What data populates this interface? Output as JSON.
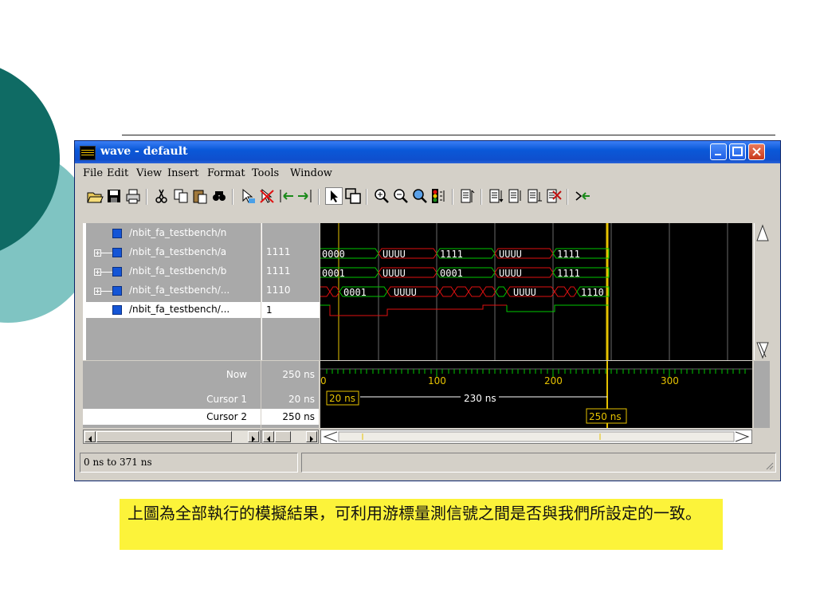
{
  "window": {
    "title": "wave - default"
  },
  "menu": [
    "File",
    "Edit",
    "View",
    "Insert",
    "Format",
    "Tools",
    "Window"
  ],
  "signals": [
    {
      "name": "/nbit_fa_testbench/n",
      "value": ""
    },
    {
      "name": "/nbit_fa_testbench/a",
      "value": "1111"
    },
    {
      "name": "/nbit_fa_testbench/b",
      "value": "1111"
    },
    {
      "name": "/nbit_fa_testbench/...",
      "value": "1110"
    },
    {
      "name": "/nbit_fa_testbench/...",
      "value": "1"
    }
  ],
  "wave_labels": {
    "a": [
      "0000",
      "UUUU",
      "1111",
      "UUUU",
      "1111"
    ],
    "b": [
      "0001",
      "UUUU",
      "0001",
      "UUUU",
      "1111"
    ],
    "sum": [
      "0001",
      "UUUU",
      "UUUU",
      "1110"
    ]
  },
  "cursors": {
    "now_label": "Now",
    "now_value": "250 ns",
    "c1_label": "Cursor 1",
    "c1_value": "20 ns",
    "c2_label": "Cursor 2",
    "c2_value": "250 ns",
    "ticks": [
      "0",
      "100",
      "200",
      "300"
    ],
    "c1_box": "20 ns",
    "delta": "230 ns",
    "c2_box": "250 ns"
  },
  "status": {
    "range": "0 ns to 371 ns"
  },
  "note": {
    "text": "上圖為全部執行的模擬結果，可利用游標量測信號之間是否與我們所設定的一致。"
  },
  "colors": {
    "teal": "#0f6b64",
    "light_teal": "#7fc4c2",
    "wave_green": "#00c800",
    "wave_red": "#e01010",
    "cursor": "#e6c200",
    "note_bg": "#fcf33a"
  }
}
